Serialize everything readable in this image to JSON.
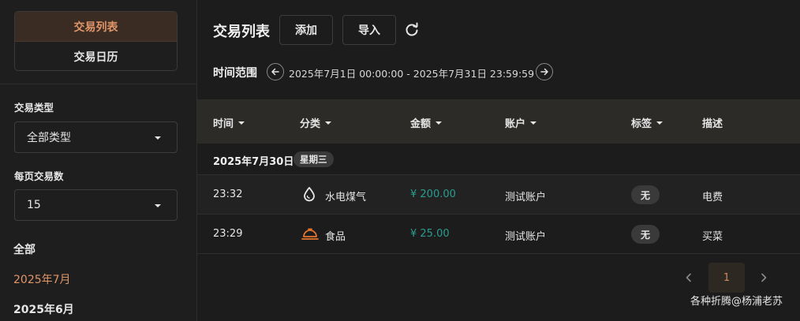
{
  "sidebar": {
    "nav": [
      {
        "label": "交易列表",
        "active": true
      },
      {
        "label": "交易日历",
        "active": false
      }
    ],
    "type_filter": {
      "label": "交易类型",
      "value": "全部类型"
    },
    "page_size": {
      "label": "每页交易数",
      "value": "15"
    },
    "months": [
      {
        "label": "全部",
        "active": false
      },
      {
        "label": "2025年7月",
        "active": true
      },
      {
        "label": "2025年6月",
        "active": false
      }
    ]
  },
  "header": {
    "title": "交易列表",
    "add_label": "添加",
    "import_label": "导入",
    "refresh_icon": "refresh-icon"
  },
  "range": {
    "label": "时间范围",
    "text": "2025年7月1日 00:00:00 - 2025年7月31日 23:59:59"
  },
  "table": {
    "columns": {
      "time": "时间",
      "category": "分类",
      "amount": "金额",
      "account": "账户",
      "tags": "标签",
      "description": "描述"
    },
    "group": {
      "date": "2025年7月30日",
      "weekday": "星期三"
    },
    "rows": [
      {
        "time": "23:32",
        "category": "水电煤气",
        "category_icon": "water-drop-icon",
        "amount": "¥ 200.00",
        "account": "测试账户",
        "tag": "无",
        "description": "电费"
      },
      {
        "time": "23:29",
        "category": "食品",
        "category_icon": "food-cloche-icon",
        "amount": "¥ 25.00",
        "account": "测试账户",
        "tag": "无",
        "description": "买菜"
      }
    ]
  },
  "pagination": {
    "current_page": "1"
  },
  "watermark": "各种折腾@杨浦老苏",
  "colors": {
    "accent": "#e0956a",
    "amount": "#2a9d8f",
    "icon_orange": "#e8742e"
  }
}
